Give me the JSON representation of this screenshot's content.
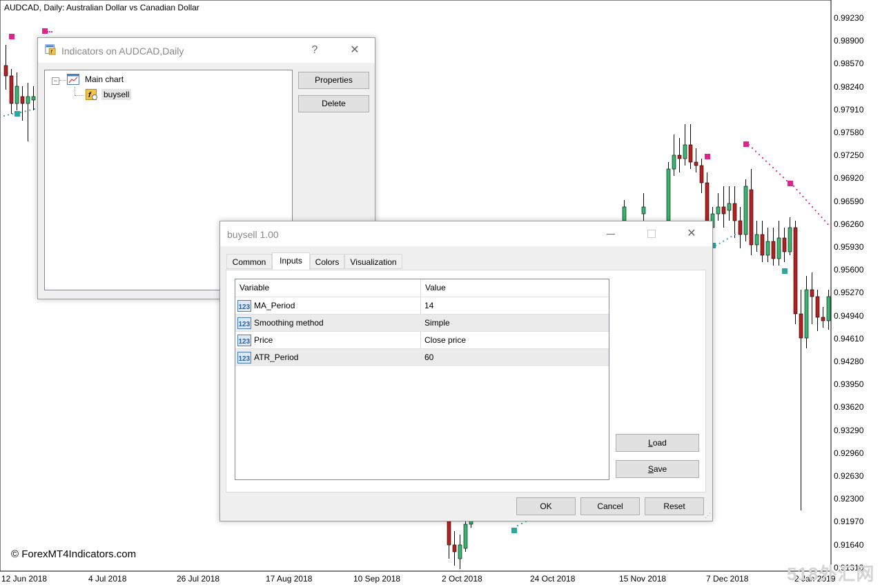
{
  "chart": {
    "title": "AUDCAD, Daily:  Australian Dollar vs Canadian Dollar",
    "price_labels": [
      "0.99230",
      "0.98900",
      "0.98570",
      "0.98240",
      "0.97910",
      "0.97580",
      "0.97250",
      "0.96920",
      "0.96590",
      "0.96260",
      "0.95930",
      "0.95600",
      "0.95270",
      "0.94940",
      "0.94610",
      "0.94280",
      "0.93950",
      "0.93620",
      "0.93290",
      "0.92960",
      "0.92630",
      "0.92300",
      "0.91970",
      "0.91640",
      "0.91310"
    ],
    "date_labels": [
      "12 Jun 2018",
      "4 Jul 2018",
      "26 Jul 2018",
      "17 Aug 2018",
      "10 Sep 2018",
      "2 Oct 2018",
      "24 Oct 2018",
      "15 Nov 2018",
      "7 Dec 2018",
      "2 Jan 2019"
    ],
    "bull_color": "#3cb371",
    "bear_color": "#b22222",
    "sell_signal_color": "#e0248e",
    "buy_signal_color": "#2aa8a0",
    "copyright": "© ForexMT4Indicators.com",
    "watermark": "518外汇网"
  },
  "indicators_dialog": {
    "title": "Indicators on AUDCAD,Daily",
    "help_glyph": "?",
    "close_glyph": "✕",
    "tree": {
      "root": "Main chart",
      "child": "buysell"
    },
    "properties_button": "Properties",
    "delete_button": "Delete"
  },
  "buysell_dialog": {
    "title": "buysell 1.00",
    "tabs": [
      "Common",
      "Inputs",
      "Colors",
      "Visualization"
    ],
    "active_tab": "Inputs",
    "columns": [
      "Variable",
      "Value"
    ],
    "rows": [
      {
        "variable": "MA_Period",
        "value": "14"
      },
      {
        "variable": "Smoothing method",
        "value": "Simple"
      },
      {
        "variable": "Price",
        "value": "Close price"
      },
      {
        "variable": "ATR_Period",
        "value": "60"
      }
    ],
    "type_icon_text": "123",
    "load_button": "Load",
    "save_button": "Save",
    "ok_button": "OK",
    "cancel_button": "Cancel",
    "reset_button": "Reset"
  }
}
